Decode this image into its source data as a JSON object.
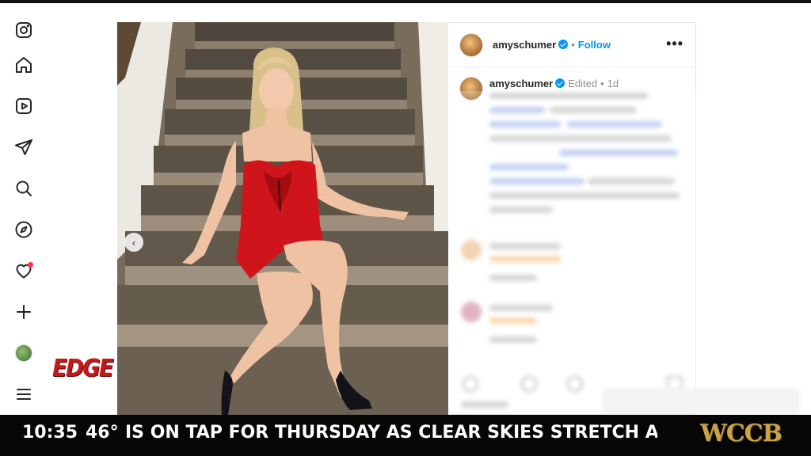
{
  "app": {
    "name": "Instagram"
  },
  "nav": {
    "items": [
      {
        "name": "instagram-logo-icon"
      },
      {
        "name": "home-icon"
      },
      {
        "name": "reels-icon"
      },
      {
        "name": "messages-icon"
      },
      {
        "name": "search-icon"
      },
      {
        "name": "explore-icon"
      },
      {
        "name": "notifications-icon",
        "badge": true
      },
      {
        "name": "create-icon"
      },
      {
        "name": "profile-avatar"
      },
      {
        "name": "more-menu-icon"
      }
    ]
  },
  "post": {
    "username": "amyschumer",
    "verified": true,
    "follow_label": "Follow",
    "more_label": "•••",
    "caption_edited": "Edited",
    "caption_age": "1d",
    "carousel_prev": "‹"
  },
  "overlay": {
    "edge_logo": "EDGE"
  },
  "ticker": {
    "time": "10:35",
    "temperature": "46°",
    "text": "IS ON TAP FOR THURSDAY AS CLEAR SKIES STRETCH ACROSS T",
    "station": "WCCB"
  },
  "colors": {
    "accent_blue": "#0095f6",
    "notification_red": "#ff3040",
    "dress_red": "#d0141b",
    "ticker_bg": "#060606",
    "station_gold": "#c9a24a"
  }
}
